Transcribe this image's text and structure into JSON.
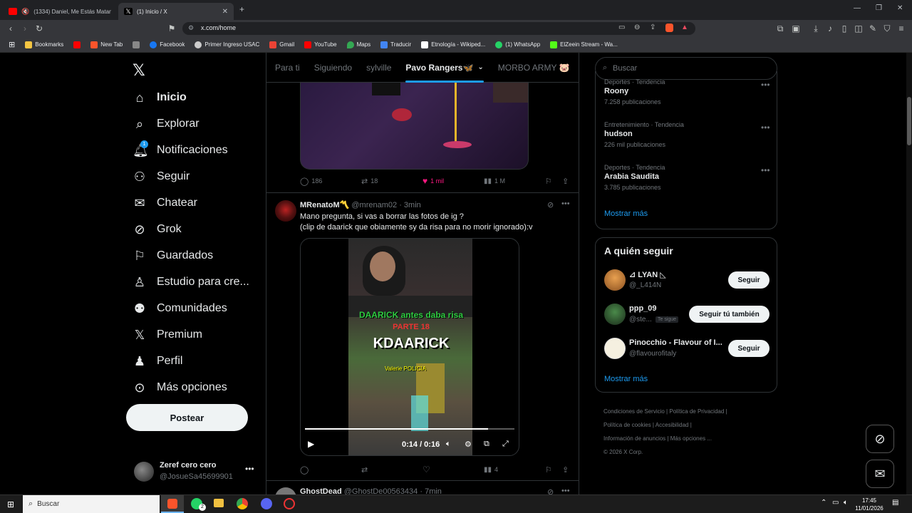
{
  "browser": {
    "tabs": [
      {
        "title": "(1334) Daniel, Me Estás Matando",
        "favicon_color": "#ff0000"
      },
      {
        "title": "(1) Inicio / X",
        "favicon_color": "#ffffff"
      }
    ],
    "url": "x.com/home",
    "bookmarks": [
      {
        "label": "Bookmarks",
        "color": "#f4c542"
      },
      {
        "label": "",
        "color": "#ff0000"
      },
      {
        "label": "New Tab",
        "color": "#fb542b"
      },
      {
        "label": "",
        "color": "#888888"
      },
      {
        "label": "Facebook",
        "color": "#1877f2"
      },
      {
        "label": "Primer Ingreso USAC",
        "color": "#cccccc"
      },
      {
        "label": "Gmail",
        "color": "#ea4335"
      },
      {
        "label": "YouTube",
        "color": "#ff0000"
      },
      {
        "label": "Maps",
        "color": "#34a853"
      },
      {
        "label": "Traducir",
        "color": "#4285f4"
      },
      {
        "label": "Etnología - Wikiped...",
        "color": "#ffffff"
      },
      {
        "label": "(1) WhatsApp",
        "color": "#25d366"
      },
      {
        "label": "ElZeein Stream - Wa...",
        "color": "#53fc18"
      }
    ]
  },
  "sidebar": {
    "items": [
      {
        "label": "Inicio",
        "icon": "home-icon"
      },
      {
        "label": "Explorar",
        "icon": "search-icon"
      },
      {
        "label": "Notificaciones",
        "icon": "bell-icon",
        "badge": "1"
      },
      {
        "label": "Seguir",
        "icon": "add-person-icon"
      },
      {
        "label": "Chatear",
        "icon": "mail-icon"
      },
      {
        "label": "Grok",
        "icon": "grok-icon"
      },
      {
        "label": "Guardados",
        "icon": "bookmark-icon"
      },
      {
        "label": "Estudio para cre...",
        "icon": "creator-icon"
      },
      {
        "label": "Comunidades",
        "icon": "communities-icon"
      },
      {
        "label": "Premium",
        "icon": "x-logo-icon"
      },
      {
        "label": "Perfil",
        "icon": "person-icon"
      },
      {
        "label": "Más opciones",
        "icon": "more-icon"
      }
    ],
    "post_label": "Postear",
    "account": {
      "name": "Zeref cero cero",
      "handle": "@JosueSa45699901"
    }
  },
  "timeline": {
    "tabs": [
      "Para ti",
      "Siguiendo",
      "sylville",
      "Pavo Rangers🦋",
      "MORBO ARMY 🐷"
    ],
    "prev_post": {
      "replies": "186",
      "reposts": "18",
      "likes": "1 mil",
      "views": "1 M"
    },
    "post": {
      "author": "MRenatoM〽️",
      "handle": "@mrenam02",
      "time": "3min",
      "text_line1": "Mano pregunta, si vas a borrar las fotos de ig ?",
      "text_line2": "(clip de daarick que obiamente sy da risa para no morir ignorado):v",
      "video": {
        "caption1": "DAARICK antes daba risa",
        "caption2": "PARTE 18",
        "caption3": "KDAARICK",
        "caption4": "Valerie  POLICIA",
        "time": "0:14 / 0:16",
        "progress": 0.875
      },
      "views": "4"
    },
    "next_post": {
      "author": "GhostDead",
      "handle": "@GhostDe00563434",
      "time": "7min"
    }
  },
  "right": {
    "search_placeholder": "Buscar",
    "trends": [
      {
        "meta": "Deportes · Tendencia",
        "title": "Roony",
        "count": "7.258 publicaciones"
      },
      {
        "meta": "Entretenimiento · Tendencia",
        "title": "hudson",
        "count": "226 mil publicaciones"
      },
      {
        "meta": "Deportes · Tendencia",
        "title": "Arabia Saudita",
        "count": "3.785 publicaciones"
      }
    ],
    "show_more": "Mostrar más",
    "who_to_follow_title": "A quién seguir",
    "suggestions": [
      {
        "name": "⊿ LYAN ◺",
        "handle": "@_L414N",
        "button": "Seguir",
        "follows_you": ""
      },
      {
        "name": "ppp_09",
        "handle": "@ste...",
        "button": "Seguir tú también",
        "follows_you": "Te sigue"
      },
      {
        "name": "Pinocchio - Flavour of I...",
        "handle": "@flavourofitaly",
        "button": "Seguir",
        "follows_you": ""
      }
    ],
    "footer": [
      "Condiciones de Servicio",
      "Política de Privacidad",
      "Política de cookies",
      "Accesibilidad",
      "Información de anuncios",
      "Más opciones ...",
      "© 2026 X Corp."
    ]
  },
  "taskbar": {
    "search_placeholder": "Buscar",
    "time": "17:45",
    "date": "11/01/2026",
    "whatsapp_badge": "2"
  }
}
